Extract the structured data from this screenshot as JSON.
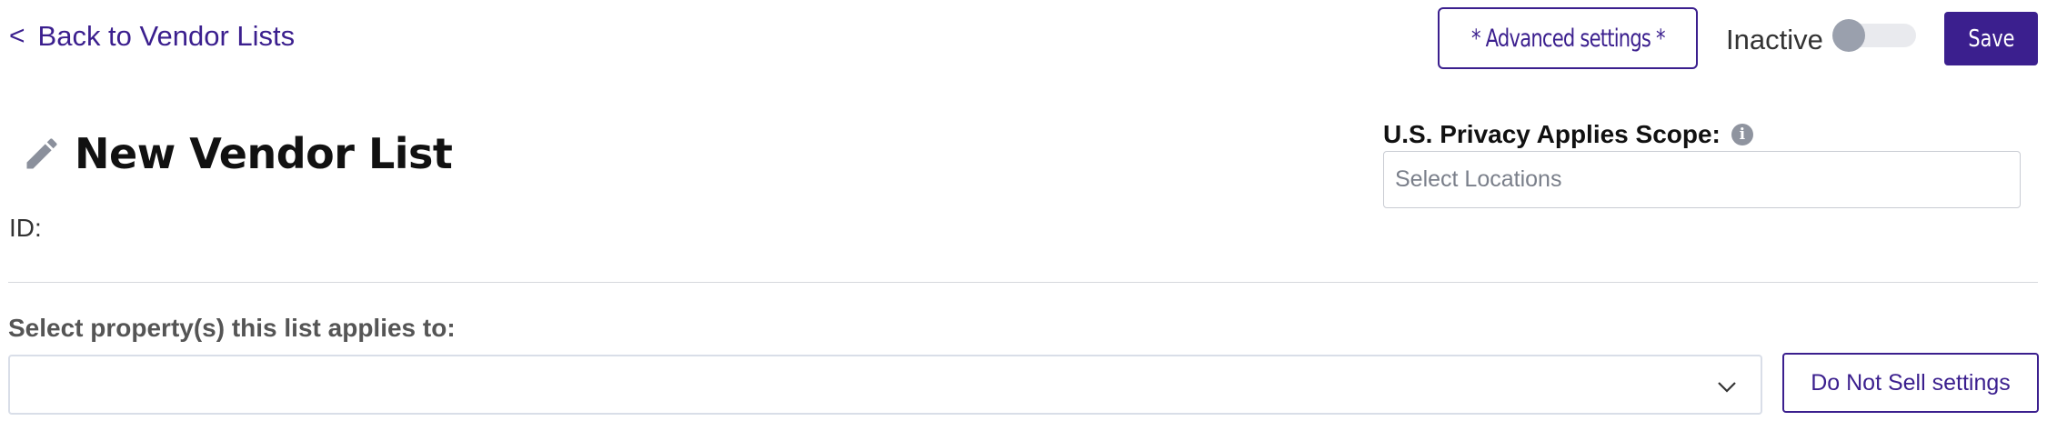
{
  "header": {
    "back_link": "Back to Vendor Lists",
    "back_chevron": "<",
    "advanced_settings_label": "* Advanced settings *",
    "status_label": "Inactive",
    "status_active": false,
    "save_label": "Save"
  },
  "vendor_list": {
    "title": "New Vendor List",
    "id_label": "ID:"
  },
  "privacy_scope": {
    "label": "U.S. Privacy Applies Scope:",
    "info_icon": "i",
    "placeholder": "Select Locations"
  },
  "properties": {
    "label": "Select property(s) this list applies to:",
    "selected_value": "",
    "do_not_sell_label": "Do Not Sell settings"
  },
  "icons": {
    "edit": "pencil-icon",
    "info": "info-icon",
    "dropdown": "chevron-down-icon"
  },
  "colors": {
    "brand": "#3b1f8e",
    "toggle_off_knob": "#9aa0ad",
    "toggle_off_track": "#e9eaee"
  }
}
